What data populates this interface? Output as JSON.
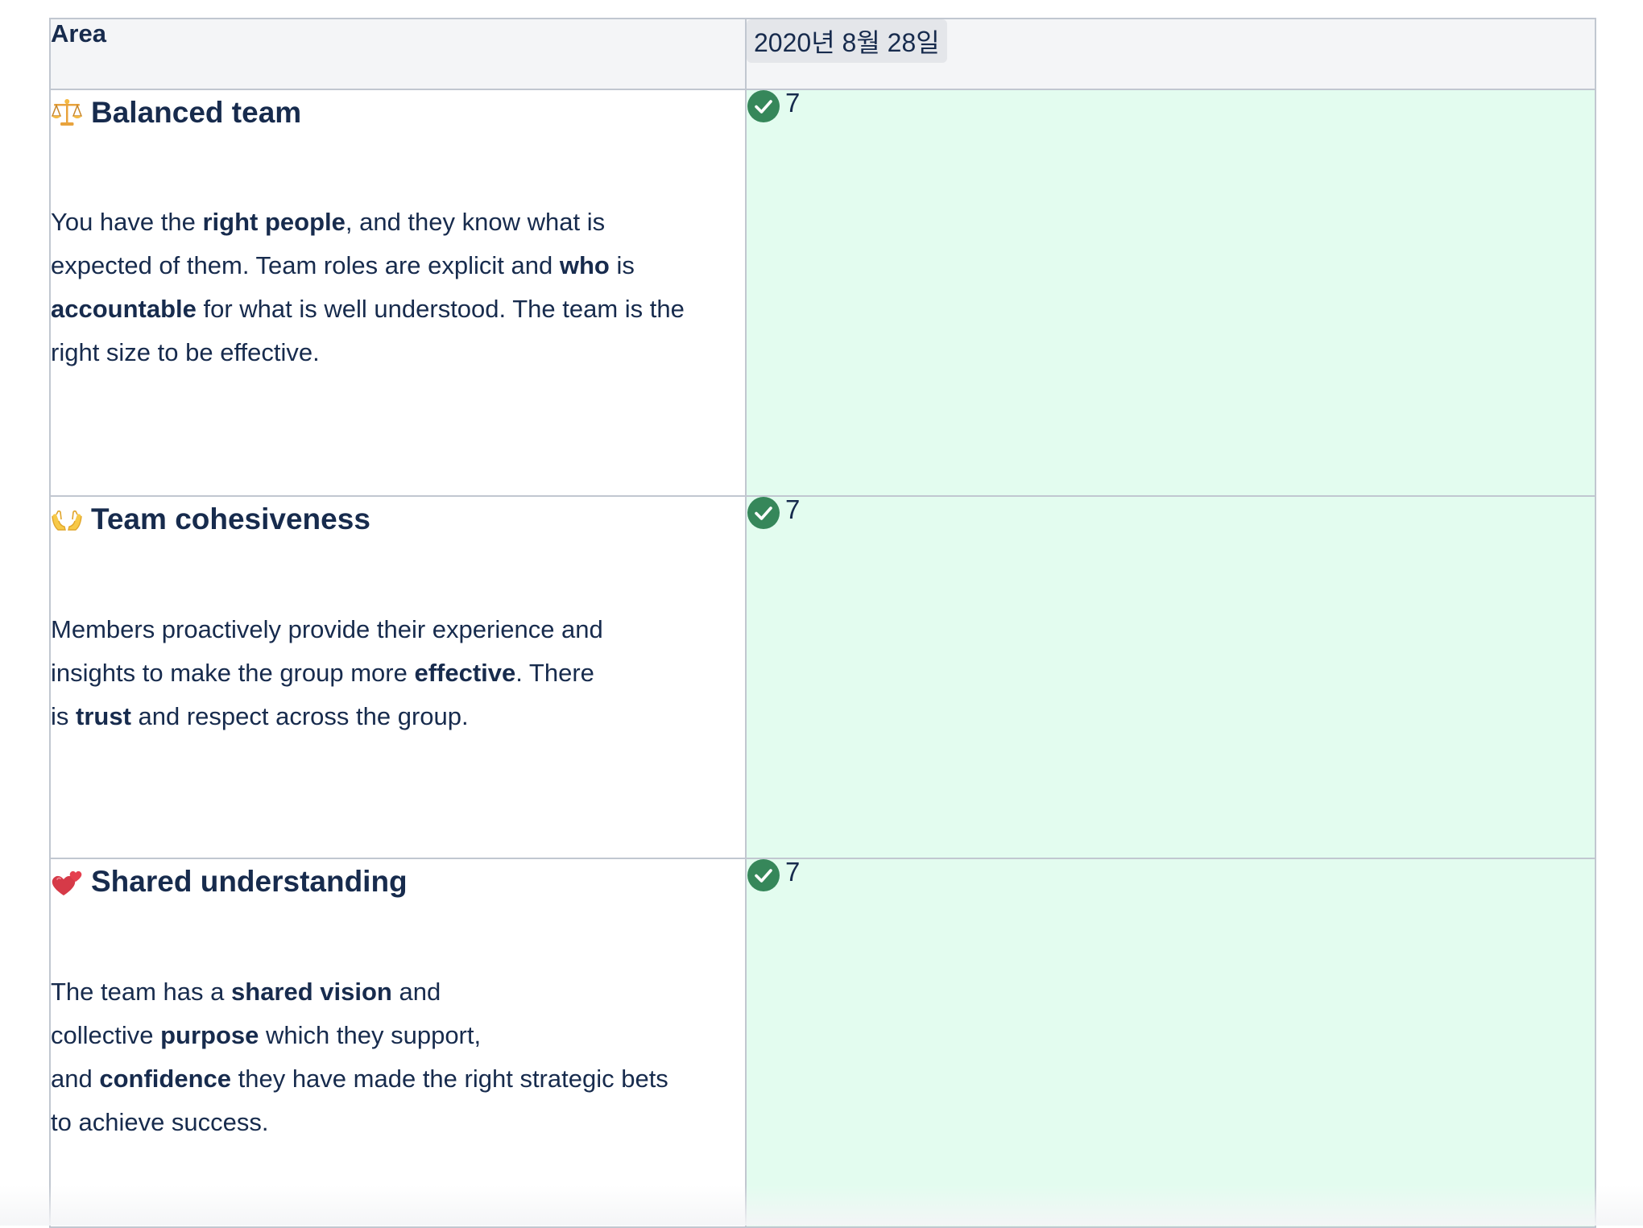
{
  "table": {
    "headers": {
      "area": "Area",
      "date": "2020년 8월 28일"
    },
    "rows": [
      {
        "icon": "balance-scale-icon",
        "title": "Balanced team",
        "desc": [
          {
            "t": "You have the "
          },
          {
            "b": "right people"
          },
          {
            "t": ", and they know what is"
          },
          {
            "br": true
          },
          {
            "t": "expected of them. Team roles are explicit and "
          },
          {
            "b": "who"
          },
          {
            "t": " is"
          },
          {
            "br": true
          },
          {
            "b": "accountable"
          },
          {
            "t": " for what is well understood. The team is the"
          },
          {
            "br": true
          },
          {
            "t": "right size to be effective."
          }
        ],
        "status_icon": "check-circle-icon",
        "score": "7"
      },
      {
        "icon": "open-hands-icon",
        "title": "Team cohesiveness",
        "desc": [
          {
            "t": "Members proactively provide their experience and"
          },
          {
            "br": true
          },
          {
            "t": "insights to make the group more "
          },
          {
            "b": "effective"
          },
          {
            "t": ". There"
          },
          {
            "br": true
          },
          {
            "t": "is "
          },
          {
            "b": "trust"
          },
          {
            "t": " and respect across the group."
          }
        ],
        "status_icon": "check-circle-icon",
        "score": "7"
      },
      {
        "icon": "two-hearts-icon",
        "title": "Shared understanding",
        "desc": [
          {
            "t": "The team has a "
          },
          {
            "b": "shared vision"
          },
          {
            "t": " and"
          },
          {
            "br": true
          },
          {
            "t": "collective "
          },
          {
            "b": "purpose"
          },
          {
            "t": " which they support,"
          },
          {
            "br": true
          },
          {
            "t": "and "
          },
          {
            "b": "confidence"
          },
          {
            "t": " they have made the right strategic bets"
          },
          {
            "br": true
          },
          {
            "t": "to achieve success."
          }
        ],
        "status_icon": "check-circle-icon",
        "score": "7"
      }
    ]
  },
  "colors": {
    "score_cell_bg": "#e3fcef",
    "header_bg": "#f4f5f7",
    "check_green": "#36875a",
    "text": "#172b4d"
  }
}
